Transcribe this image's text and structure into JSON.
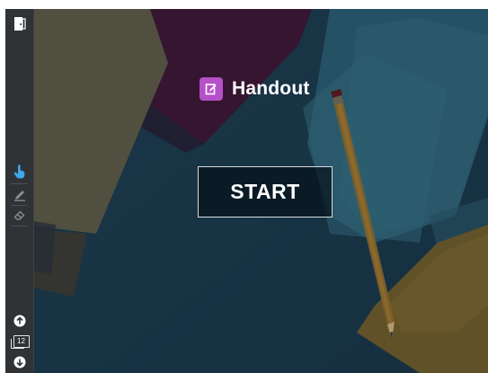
{
  "app": {
    "title": "Handout",
    "brand_color": "#b551c8",
    "background_color": "#1c3c4f"
  },
  "main": {
    "start_label": "START"
  },
  "sidebar": {
    "top_icon": "door-exit-icon",
    "tools": [
      {
        "name": "hand-pointer-icon",
        "active": true,
        "color": "#3fa6e8"
      },
      {
        "name": "pen-icon",
        "active": false
      },
      {
        "name": "eraser-icon",
        "active": false
      }
    ],
    "page_count": "12",
    "nav": [
      "arrow-up-icon",
      "pages-icon",
      "arrow-down-icon"
    ]
  }
}
